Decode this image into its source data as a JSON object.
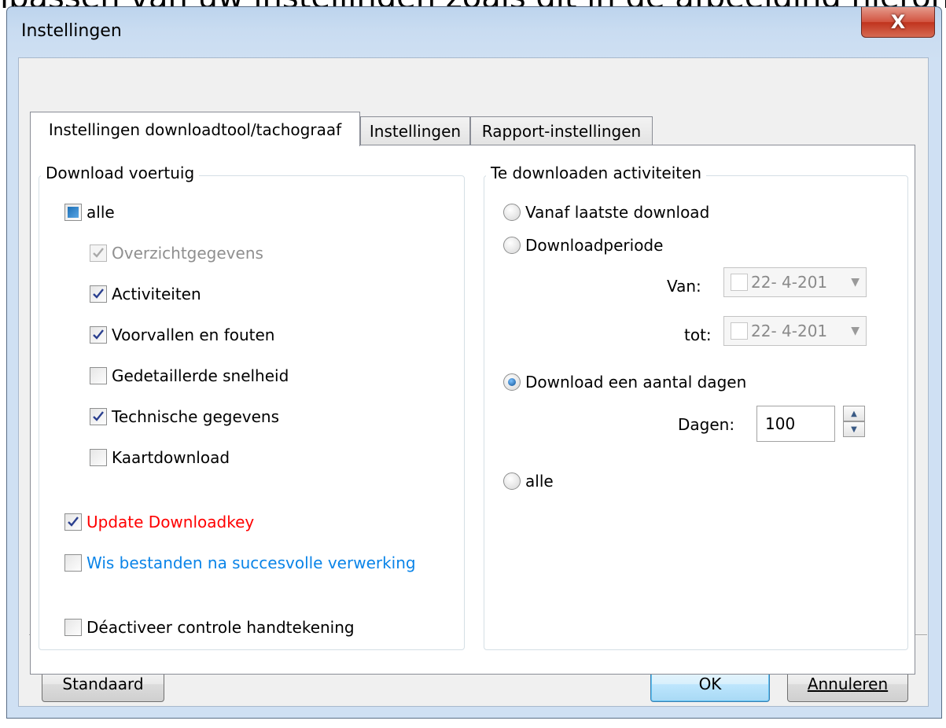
{
  "window": {
    "title": "Instellingen",
    "close_label": "X"
  },
  "tabs": [
    {
      "label": "Instellingen downloadtool/tachograaf",
      "active": true
    },
    {
      "label": "Instellingen",
      "active": false
    },
    {
      "label": "Rapport-instellingen",
      "active": false
    }
  ],
  "download_vehicle": {
    "group_label": "Download voertuig",
    "all": {
      "label": "alle",
      "state": "indeterminate"
    },
    "items": [
      {
        "label": "Overzichtgegevens",
        "checked": true,
        "disabled": true
      },
      {
        "label": "Activiteiten",
        "checked": true
      },
      {
        "label": "Voorvallen en fouten",
        "checked": true
      },
      {
        "label": "Gedetaillerde snelheid",
        "checked": false
      },
      {
        "label": "Technische gegevens",
        "checked": true
      },
      {
        "label": "Kaartdownload",
        "checked": false
      }
    ],
    "update_key": {
      "label": "Update Downloadkey",
      "checked": true,
      "color": "#ff0000"
    },
    "delete_files": {
      "label": "Wis bestanden na succesvolle verwerking",
      "checked": false,
      "color": "#0a84e8"
    },
    "disable_signature": {
      "label": "Déactiveer controle handtekening",
      "checked": false
    }
  },
  "activities": {
    "group_label": "Te downloaden activiteiten",
    "radio_since_last": "Vanaf laatste download",
    "radio_period": "Downloadperiode",
    "from_label": "Van:",
    "from_value": "22- 4-201",
    "to_label": "tot:",
    "to_value": "22- 4-201",
    "radio_days": "Download een aantal dagen",
    "days_label": "Dagen:",
    "days_value": "100",
    "radio_all": "alle",
    "selected": "days"
  },
  "buttons": {
    "standard": "Standaard",
    "ok": "OK",
    "cancel": "Annuleren"
  },
  "background_caption": "lpassen van uw instellingen zoals dit in de afbeelding hieronder weergegeven"
}
